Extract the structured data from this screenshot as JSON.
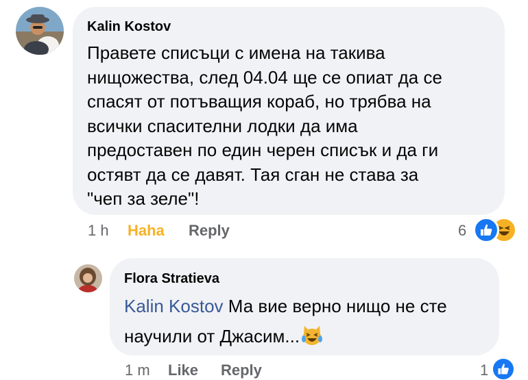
{
  "comment": {
    "author": "Kalin Kostov",
    "lines": [
      "Правете списъци с имена на такива",
      "нищожества, след 04.04 ще се опиат да се",
      "спасят от потъващия кораб, но трябва на",
      "всички спасителни лодки да има",
      "предоставен по един черен списък и да ги",
      "остявт да се давят. Тая сган не става за",
      "\"чеп за зеле\"!"
    ],
    "time": "1 h",
    "reaction_label": "Haha",
    "reply_label": "Reply",
    "reaction_count": "6",
    "reaction_icons": [
      "like-reaction-icon",
      "haha-reaction-icon"
    ],
    "colors": {
      "like": "#1877f2",
      "haha": "#f7b125"
    }
  },
  "reply": {
    "author": "Flora Stratieva",
    "mention": "Kalin Kostov",
    "line1_rest": " Ма вие верно нищо не сте",
    "line2": "научили от Джасим...",
    "emoji": "crying-laughing-cat-emoji",
    "time": "1 m",
    "like_label": "Like",
    "reply_label": "Reply",
    "reaction_count": "1",
    "reaction_icons": [
      "like-reaction-icon"
    ]
  }
}
